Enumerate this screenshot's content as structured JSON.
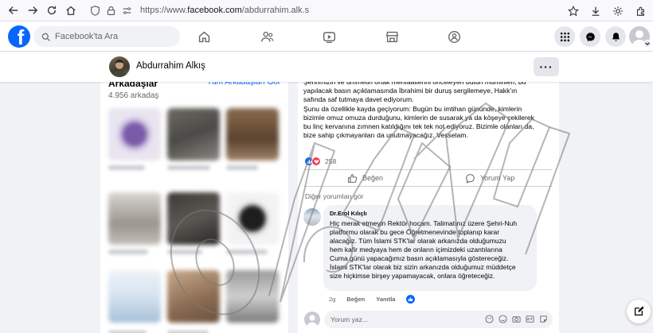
{
  "browser": {
    "url_prefix": "https://www.",
    "url_host": "facebook.com",
    "url_path": "/abdurrahim.alk.s"
  },
  "header": {
    "search_placeholder": "Facebook'ta Ara",
    "logo_letter": "f"
  },
  "profile": {
    "name": "Abdurrahim Alkış",
    "more_label": "···"
  },
  "friends": {
    "title": "Arkadaşlar",
    "see_all": "Tüm Arkadaşları Gör",
    "count": "4.956 arkadaş"
  },
  "post": {
    "lines": [
      "Şehrimizin ve ümmetin ortak menfaatlerini önceleyen bütün müminleri; bu",
      "yapılacak basın açıklamasında İbrahimi bir duruş sergilemeye, Hakk'ın",
      "safında saf tutmaya davet ediyorum.",
      "Şunu da özellikle kayda geçiyorum: Bugün bu imtihan gününde, kimlerin",
      "bizimle omuz omuza durduğunu, kimlerin de susarak ya da köşeye çekilerek",
      "bu linç kervanına zımnen katıldığını tek tek not ediyoruz. Bizimle olanları da,",
      "bize sahip çıkmayanları da unutmayacağız. Vesselam."
    ],
    "reaction_count": "258",
    "like_label": "Beğen",
    "comment_label": "Yorum Yap",
    "more_comments": "Diğer yorumları gör"
  },
  "comment": {
    "author": "Dr.Erol Kılıçlı",
    "lines": [
      "Hiç merak etmeyin Rektör hocam. Talimatınız üzere Şehri-Nuh",
      "platformu olarak bu gece Öğretmenevinde toplanıp karar",
      "alacağız. Tüm İslami STK'lar olarak arkanızda olduğumuzu",
      "hem kafir medyaya hem de onların içimizdeki uzantılarına",
      "Cuma günü yapacağımız basın açıklamasıyla göstereceğiz.",
      "İslami STK'lar olarak biz sizin arkanızda olduğumuz müddetçe",
      "size hiçkimse birşey yapamayacak, onlara öğreteceğiz."
    ],
    "time": "2g",
    "like_label": "Beğen",
    "reply_label": "Yanıtla"
  },
  "composer": {
    "placeholder": "Yorum yaz..."
  },
  "watermark": {
    "text": "odatv"
  },
  "colors": {
    "brand": "#0866ff",
    "love": "#f33e58",
    "page_bg": "#f0f2f5"
  }
}
